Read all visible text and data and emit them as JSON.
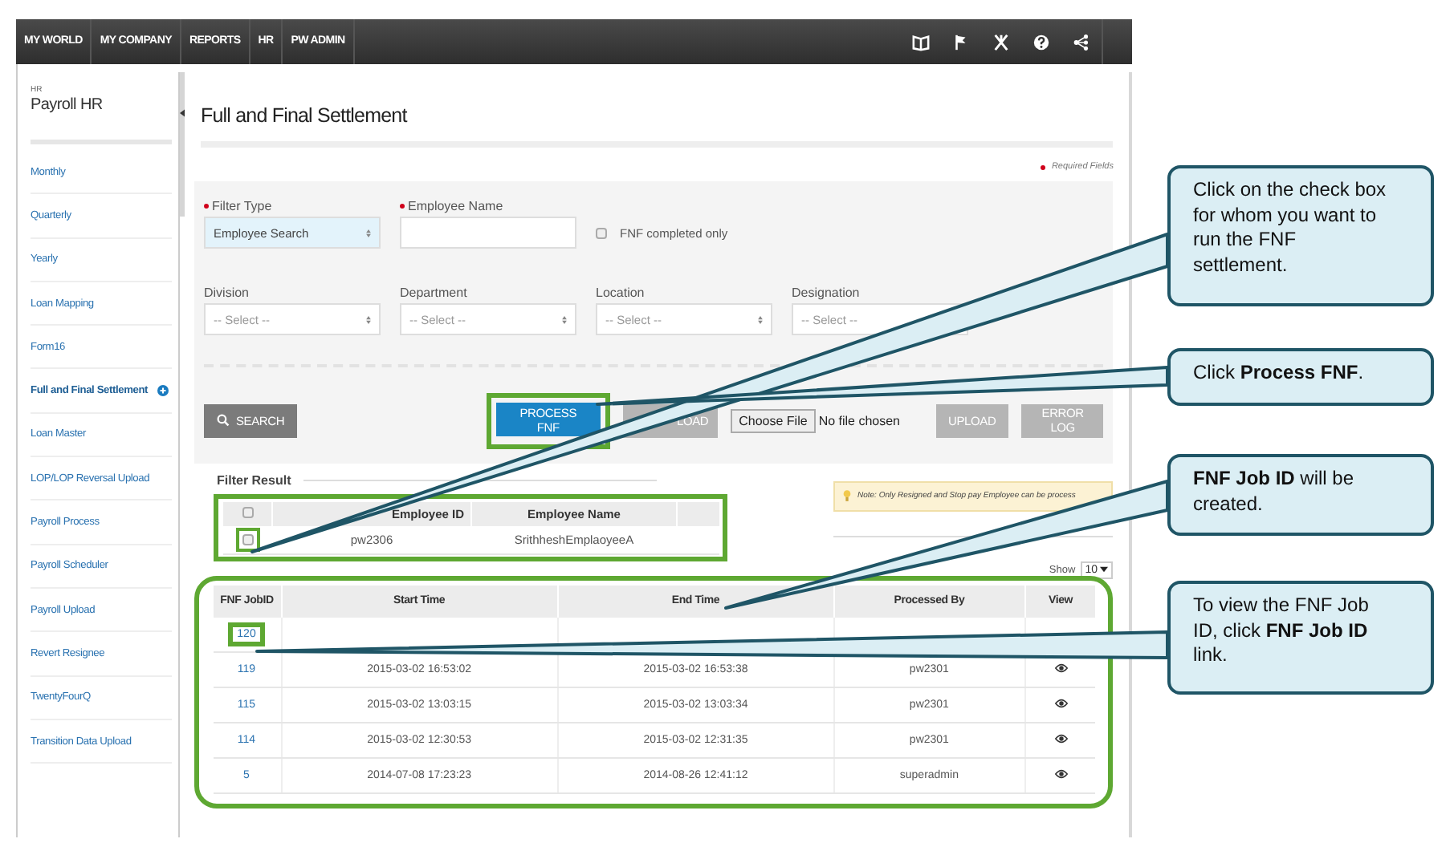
{
  "top_nav": {
    "items": [
      {
        "label": "MY WORLD"
      },
      {
        "label": "MY COMPANY"
      },
      {
        "label": "REPORTS"
      },
      {
        "label": "HR"
      },
      {
        "label": "PW ADMIN"
      }
    ]
  },
  "sidebar": {
    "section": "HR",
    "title": "Payroll HR",
    "items": [
      {
        "label": "Monthly",
        "selected": false
      },
      {
        "label": "Quarterly",
        "selected": false
      },
      {
        "label": "Yearly",
        "selected": false
      },
      {
        "label": "Loan Mapping",
        "selected": false
      },
      {
        "label": "Form16",
        "selected": false
      },
      {
        "label": "Full and Final Settlement",
        "selected": true
      },
      {
        "label": "Loan Master",
        "selected": false
      },
      {
        "label": "LOP/LOP Reversal Upload",
        "selected": false
      },
      {
        "label": "Payroll Process",
        "selected": false
      },
      {
        "label": "Payroll Scheduler",
        "selected": false
      },
      {
        "label": "Payroll Upload",
        "selected": false
      },
      {
        "label": "Revert Resignee",
        "selected": false
      },
      {
        "label": "TwentyFourQ",
        "selected": false
      },
      {
        "label": "Transition Data Upload",
        "selected": false
      }
    ]
  },
  "page": {
    "title": "Full and Final Settlement",
    "required_note": "Required Fields"
  },
  "filters": {
    "rows": [
      [
        {
          "kind": "select",
          "label": "Filter Type",
          "required": true,
          "value": "Employee Search",
          "highlighted": true
        },
        {
          "kind": "text",
          "label": "Employee Name",
          "required": true
        },
        {
          "kind": "checkbox",
          "label": "FNF completed only",
          "checked": false
        }
      ],
      [
        {
          "kind": "select",
          "label": "Division",
          "required": false,
          "placeholder": "-- Select --",
          "highlighted": false
        },
        {
          "kind": "select",
          "label": "Department",
          "required": false,
          "placeholder": "-- Select --",
          "highlighted": false
        },
        {
          "kind": "select",
          "label": "Location",
          "required": false,
          "placeholder": "-- Select --",
          "highlighted": false
        },
        {
          "kind": "select",
          "label": "Designation",
          "required": false,
          "placeholder": "-- Select --",
          "highlighted": false
        }
      ]
    ]
  },
  "actions": {
    "search": "SEARCH",
    "process": "PROCESS FNF",
    "button_3": {
      "label": "LOAD",
      "disabled": true
    },
    "file_button": "Choose File",
    "file_status": "No file chosen",
    "upload": {
      "label": "UPLOAD",
      "disabled": true
    },
    "error_log": {
      "label": "ERROR LOG",
      "disabled": true
    }
  },
  "filter_result": {
    "title": "Filter Result",
    "header_checked": false,
    "columns": [
      "Employee ID",
      "Employee Name"
    ],
    "rows": [
      {
        "checked": false,
        "employee_id": "pw2306",
        "employee_name": "SrithheshEmplaoyeeA"
      }
    ],
    "note": "Note: Only Resigned and Stop pay Employee can be process"
  },
  "show": {
    "label": "Show",
    "value": "10"
  },
  "jobs": {
    "columns": [
      "FNF JobID",
      "Start Time",
      "End Time",
      "Processed By",
      "View"
    ],
    "rows": [
      {
        "job_id": "120"
      },
      {
        "job_id": "119",
        "start": "2015-03-02 16:53:02",
        "end": "2015-03-02 16:53:38",
        "by": "pw2301"
      },
      {
        "job_id": "115",
        "start": "2015-03-02 13:03:15",
        "end": "2015-03-02 13:03:34",
        "by": "pw2301"
      },
      {
        "job_id": "114",
        "start": "2015-03-02 12:30:53",
        "end": "2015-03-02 12:31:35",
        "by": "pw2301"
      },
      {
        "job_id": "5",
        "start": "2014-07-08 17:23:23",
        "end": "2014-08-26 12:41:12",
        "by": "superadmin"
      }
    ]
  },
  "callouts": [
    {
      "text": "Click on the check box for whom you want to run the FNF settlement."
    },
    {
      "text": "Click **Process FNF**."
    },
    {
      "text": "**FNF Job ID** will be created."
    },
    {
      "text": "To view the FNF Job ID, click **FNF Job ID** link."
    }
  ]
}
